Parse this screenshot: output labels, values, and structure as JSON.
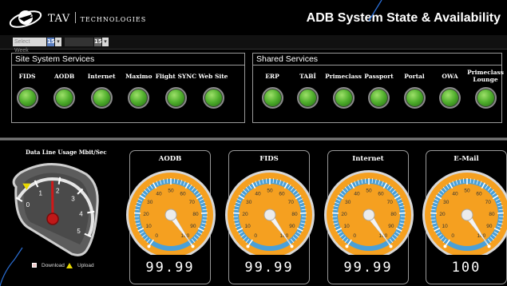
{
  "header": {
    "brand_name": "TAV",
    "brand_suffix": "TECHNOLOGIES",
    "title": "ADB System State & Availability"
  },
  "datebar": {
    "date_from_value": "Select Week",
    "date_from_icon": "calendar-icon",
    "date_to_value": "",
    "calendar_day": "15"
  },
  "site_services": {
    "title": "Site System Services",
    "items": [
      {
        "label": "FIDS",
        "status_color": "#4fae2c"
      },
      {
        "label": "AODB",
        "status_color": "#4fae2c"
      },
      {
        "label": "Internet",
        "status_color": "#4fae2c"
      },
      {
        "label": "Maximo",
        "status_color": "#4fae2c"
      },
      {
        "label": "Flight SYNC",
        "status_color": "#4fae2c"
      },
      {
        "label": "Web Site",
        "status_color": "#4fae2c"
      }
    ]
  },
  "shared_services": {
    "title": "Shared Services",
    "items": [
      {
        "label": "ERP",
        "status_color": "#4fae2c"
      },
      {
        "label": "TABİ",
        "status_color": "#4fae2c"
      },
      {
        "label": "Primeclass",
        "status_color": "#4fae2c"
      },
      {
        "label": "Passport",
        "status_color": "#4fae2c"
      },
      {
        "label": "Portal",
        "status_color": "#4fae2c"
      },
      {
        "label": "OWA",
        "status_color": "#4fae2c"
      },
      {
        "label": "Primeclass Lounge",
        "status_color": "#4fae2c"
      }
    ]
  },
  "data_line": {
    "title": "Data Line Usage Mbit/Sec",
    "ticks": [
      "0",
      "1",
      "2",
      "3",
      "4",
      "5"
    ],
    "download_label": "Download",
    "upload_label": "Upload",
    "upload_marker_value": 0.6,
    "needle_value": 1.7
  },
  "gauges": [
    {
      "title": "AODB",
      "readout": "99.99",
      "value": 99.99
    },
    {
      "title": "FIDS",
      "readout": "99.99",
      "value": 99.99
    },
    {
      "title": "Internet",
      "readout": "99.99",
      "value": 99.99
    },
    {
      "title": "E-Mail",
      "readout": "100",
      "value": 100
    }
  ],
  "gauge_scale": [
    "0",
    "10",
    "20",
    "30",
    "40",
    "50",
    "60",
    "70",
    "80",
    "90",
    "100"
  ],
  "colors": {
    "accent_blue": "#2b6fd6",
    "gauge_orange": "#f5a020",
    "gauge_blue": "#4aa0d8",
    "status_green": "#4fae2c",
    "download_marker": "#f0c8c8",
    "upload_marker": "#e8d800"
  }
}
